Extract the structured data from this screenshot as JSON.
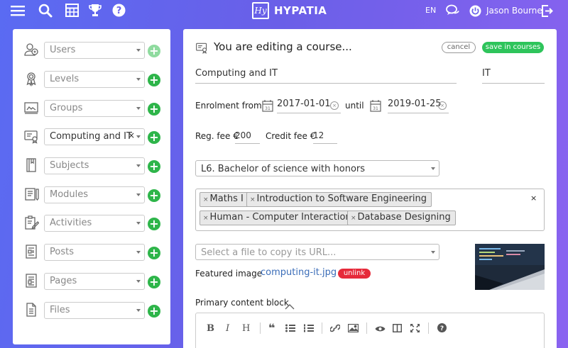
{
  "topbar": {
    "brand_logo": "Hy",
    "brand_name": "HYPATIA",
    "language": "EN",
    "user_name": "Jason Bourne",
    "icons": [
      "menu-icon",
      "search-icon",
      "table-icon",
      "trophy-icon",
      "help-icon",
      "chat-icon",
      "power-icon",
      "logout-icon"
    ]
  },
  "sidebar": {
    "items": [
      {
        "label": "Users",
        "icon": "users-icon",
        "selected": false
      },
      {
        "label": "Levels",
        "icon": "award-icon",
        "selected": false
      },
      {
        "label": "Groups",
        "icon": "groups-icon",
        "selected": false
      },
      {
        "label": "Computing and IT",
        "icon": "course-icon",
        "selected": true
      },
      {
        "label": "Subjects",
        "icon": "subjects-icon",
        "selected": false
      },
      {
        "label": "Modules",
        "icon": "modules-icon",
        "selected": false
      },
      {
        "label": "Activities",
        "icon": "activities-icon",
        "selected": false
      },
      {
        "label": "Posts",
        "icon": "posts-icon",
        "selected": false
      },
      {
        "label": "Pages",
        "icon": "pages-icon",
        "selected": false
      },
      {
        "label": "Files",
        "icon": "files-icon",
        "selected": false
      }
    ]
  },
  "main": {
    "heading": "You are editing a course...",
    "cancel_label": "cancel",
    "save_label": "save in courses",
    "course_name": "Computing and IT",
    "course_code": "IT",
    "enrolment_from_label": "Enrolment from",
    "date_from": "2017-01-01",
    "until_label": "until",
    "date_until": "2019-01-25",
    "reg_fee_label": "Reg. fee €",
    "reg_fee": "200",
    "credit_fee_label": "Credit fee €",
    "credit_fee": "12",
    "level_select": "L6. Bachelor of science with honors",
    "subjects": [
      "Maths I",
      "Introduction to Software Engineering",
      "Human - Computer Interaction",
      "Database Designing"
    ],
    "subjects_clear": "×",
    "file_placeholder": "Select a file to copy its URL...",
    "featured_label": "Featured image",
    "featured_file": "computing-it.jpg",
    "unlink_label": "unlink",
    "content_block_label": "Primary content block",
    "date_icon_text": "31"
  },
  "colors": {
    "accent_green": "#2ec45b",
    "danger_red": "#e62a3a",
    "link_blue": "#3b6db8"
  }
}
